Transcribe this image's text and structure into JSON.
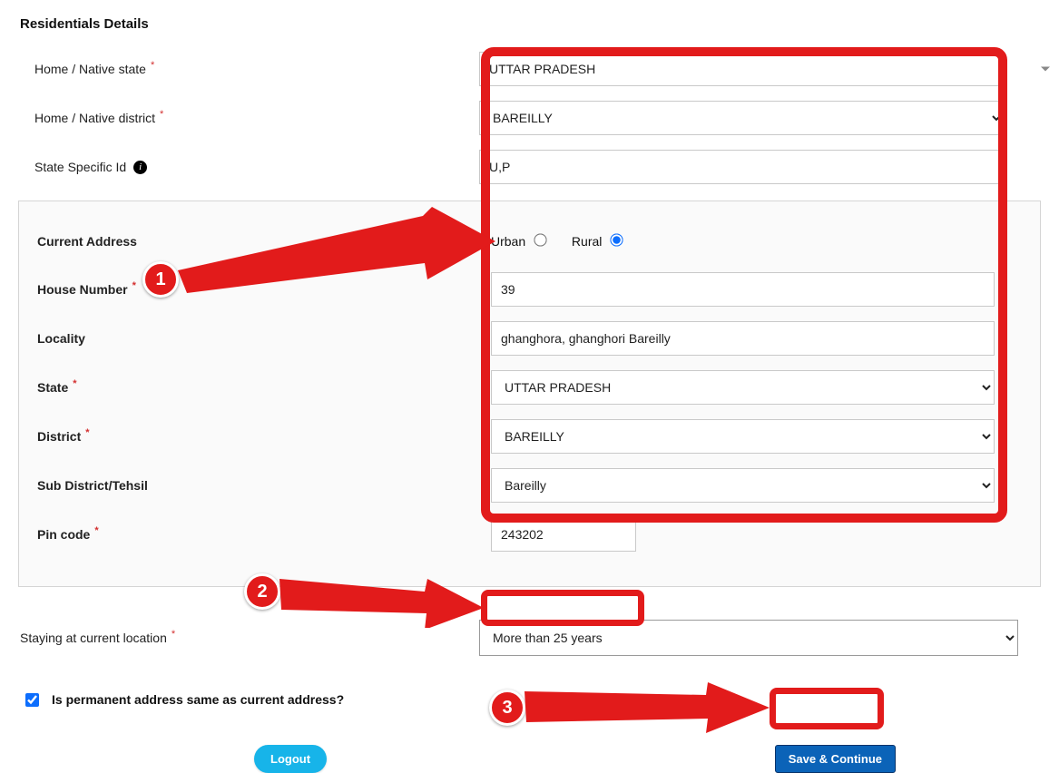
{
  "section_title": "Residentials Details",
  "home_state": {
    "label": "Home / Native state",
    "value": "UTTAR PRADESH"
  },
  "home_district": {
    "label": "Home / Native district",
    "value": "BAREILLY"
  },
  "state_specific_id": {
    "label": "State Specific Id",
    "value": "U,P"
  },
  "address": {
    "title_label": "Current Address",
    "urban_label": "Urban",
    "rural_label": "Rural",
    "area_selected": "rural",
    "house_number": {
      "label": "House Number",
      "value": "39"
    },
    "locality": {
      "label": "Locality",
      "value": "ghanghora, ghanghori Bareilly"
    },
    "state": {
      "label": "State",
      "value": "UTTAR PRADESH"
    },
    "district": {
      "label": "District",
      "value": "BAREILLY"
    },
    "sub_district": {
      "label": "Sub District/Tehsil",
      "value": "Bareilly"
    },
    "pin": {
      "label": "Pin code",
      "value": "243202"
    }
  },
  "stay": {
    "label": "Staying at current location",
    "value": "More than 25 years"
  },
  "permanent_same": {
    "label": "Is permanent address same as current address?",
    "checked": true
  },
  "buttons": {
    "logout": "Logout",
    "save": "Save & Continue"
  },
  "annotations": {
    "n1": "1",
    "n2": "2",
    "n3": "3"
  }
}
